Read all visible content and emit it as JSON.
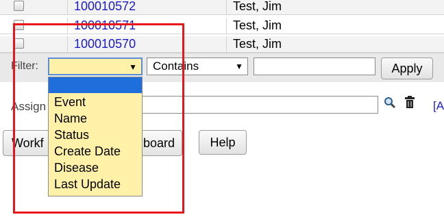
{
  "rows": [
    {
      "id": "100010572",
      "name": "Test, Jim"
    },
    {
      "id": "100010571",
      "name": "Test, Jim"
    },
    {
      "id": "100010570",
      "name": "Test, Jim"
    }
  ],
  "filter": {
    "label": "Filter:",
    "field_selected": "",
    "operator": "Contains",
    "value": "",
    "apply_label": "Apply"
  },
  "dropdown_options": [
    "Event",
    "Name",
    "Status",
    "Create Date",
    "Disease",
    "Last Update"
  ],
  "assign": {
    "label": "Assign",
    "value": "",
    "partial_link": "[A"
  },
  "buttons": {
    "workflow_left": "Workf",
    "workflow_right": "board",
    "help": "Help"
  },
  "colors": {
    "highlight": "#e8151b",
    "dropdown_bg": "#fff2a8",
    "selected_option": "#1e6fdc",
    "link": "#1a1ac8"
  },
  "icons": [
    "checkbox-icon",
    "caret-down-icon",
    "search-icon",
    "trash-icon"
  ]
}
